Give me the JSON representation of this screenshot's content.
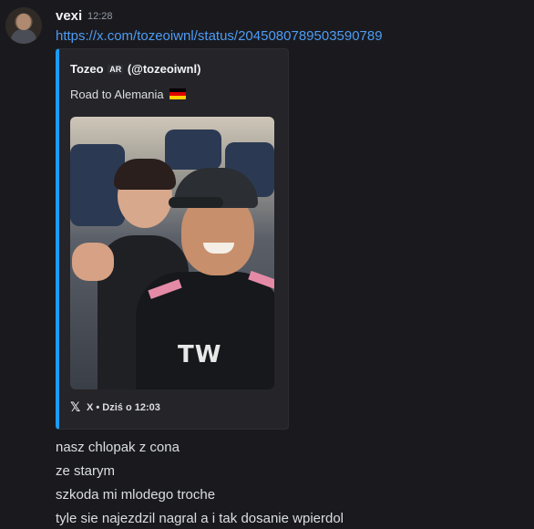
{
  "message": {
    "username": "vexi",
    "timestamp": "12:28",
    "link": "https://x.com/tozeoiwnl/status/2045080789503590789",
    "lines": [
      "nasz chlopak z cona",
      "ze starym",
      "szkoda mi mlodego troche",
      "tyle sie najezdzil nagral a i tak dosanie wpierdol"
    ]
  },
  "embed": {
    "author_name": "Tozeo",
    "author_badge": "AR",
    "author_handle": "(@tozeoiwnl)",
    "description": "Road to Alemania",
    "image_text": "TW",
    "footer_icon": "x-logo-icon",
    "footer_text": "X • Dziś o 12:03",
    "accent_color": "#1d9bf0"
  },
  "colors": {
    "background": "#1a1a1e",
    "link": "#4d9cf5",
    "embed_background": "#242429"
  }
}
